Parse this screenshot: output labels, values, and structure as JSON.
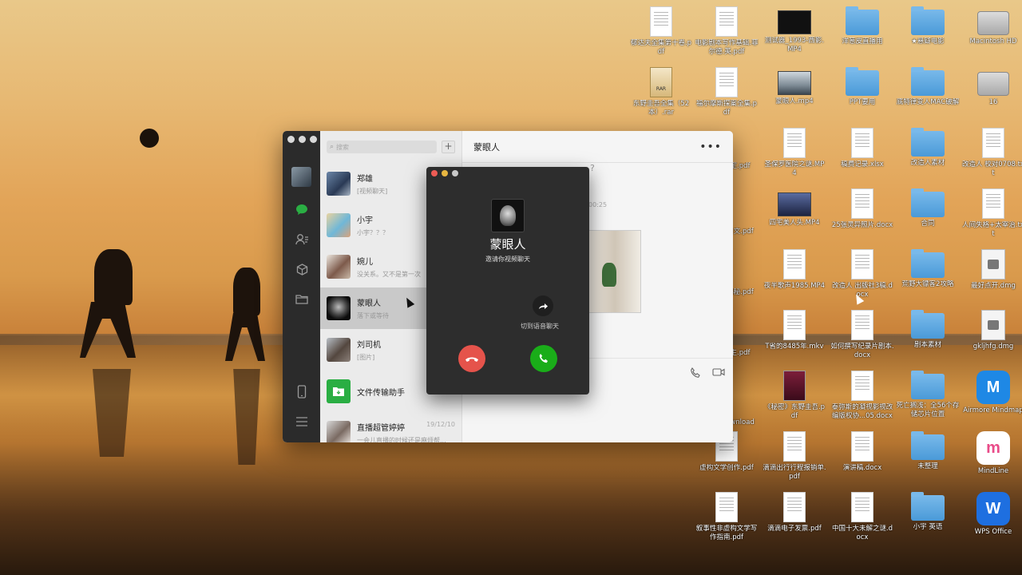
{
  "desktop": {
    "icons": [
      {
        "label": "郁达夫全集第十卷.pdf",
        "type": "doc"
      },
      {
        "label": "电影剧本写作基础.菲尔德.英.pdf",
        "type": "doc"
      },
      {
        "label": "测试器_1993-西影.MP4",
        "type": "video"
      },
      {
        "label": "洋葱皮直播用",
        "type": "folder"
      },
      {
        "label": "★悬疑电影",
        "type": "folder"
      },
      {
        "label": "Macintosh HD",
        "type": "disk"
      },
      {
        "label": "东野圭吾全集（52本）.rar",
        "type": "rar"
      },
      {
        "label": "福尔摩斯探案全集.pdf",
        "type": "doc"
      },
      {
        "label": "蒙眼人.mp4",
        "type": "video"
      },
      {
        "label": "PPT要用",
        "type": "folder"
      },
      {
        "label": "底特律变人MAC破解",
        "type": "folder"
      },
      {
        "label": "16",
        "type": "disk"
      },
      {
        "label": "圣保罗医院之谜.MP4",
        "type": "doc"
      },
      {
        "label": "稿费记录.xlsx",
        "type": "doc"
      },
      {
        "label": "改造人素材",
        "type": "folder"
      },
      {
        "label": "改造人 校对0708.txt",
        "type": "doc"
      },
      {
        "label": "四宅美人头.MP4",
        "type": "video"
      },
      {
        "label": "25张灵异照片.docx",
        "type": "doc"
      },
      {
        "label": "合同",
        "type": "folder"
      },
      {
        "label": "人间失格+太宰治.txt",
        "type": "doc"
      },
      {
        "label": "夜半歌声1985.MP4",
        "type": "doc"
      },
      {
        "label": "改造人 出版社3稿.docx",
        "type": "doc"
      },
      {
        "label": "荒野大镖客2攻略",
        "type": "folder"
      },
      {
        "label": "最好点开.dmg",
        "type": "dmg"
      },
      {
        "label": "T省的8485年.mkv",
        "type": "doc"
      },
      {
        "label": "如何撰写纪录片剧本.docx",
        "type": "doc"
      },
      {
        "label": "剧本素材",
        "type": "folder"
      },
      {
        "label": "gkljhfg.dmg",
        "type": "dmg"
      },
      {
        "label": "《秘密》东野圭吾.pdf",
        "type": "book"
      },
      {
        "label": "泰弥斯的凝视影视改编版权协...05.docx",
        "type": "doc"
      },
      {
        "label": "死亡搁浅：全56个存储芯片位置",
        "type": "folder"
      },
      {
        "label": "Airmore Mindmap",
        "type": "app"
      },
      {
        "label": "虚构文学创作.pdf",
        "type": "doc"
      },
      {
        "label": "滴滴出行行程报销单.pdf",
        "type": "doc"
      },
      {
        "label": "演讲稿.docx",
        "type": "doc"
      },
      {
        "label": "未整理",
        "type": "folder"
      },
      {
        "label": "MindLine",
        "type": "app"
      },
      {
        "label": "叙事性非虚构文学写作指南.pdf",
        "type": "doc"
      },
      {
        "label": "滴滴电子发票.pdf",
        "type": "doc"
      },
      {
        "label": "中国十大未解之谜.docx",
        "type": "doc"
      },
      {
        "label": "小宇 英语",
        "type": "folder"
      },
      {
        "label": "WPS Office",
        "type": "app"
      }
    ],
    "partial_labels": {
      "pdf1": "定.pdf",
      "pdf2": "与文.pdf",
      "pdf3": "揭秘.pdf",
      "pdf4": "生.pdf",
      "download": "ownload"
    },
    "file_tags": {
      "rar": "RAR",
      "xlsx": "XLSX",
      "txt": "TXT",
      "docx": "DOCX",
      "pdf": "PDF"
    }
  },
  "wechat": {
    "search_placeholder": "搜索",
    "plus_label": "+",
    "conversation_title": "蒙眼人",
    "more_label": "•••",
    "chats": [
      {
        "name": "郑雄",
        "msg": "[视频聊天]",
        "time": ""
      },
      {
        "name": "小宇",
        "msg": "小宇？？？",
        "time": ""
      },
      {
        "name": "婉儿",
        "msg": "没关系。又不是第一次",
        "time": ""
      },
      {
        "name": "蒙眼人",
        "msg": "落下或等待",
        "time": ""
      },
      {
        "name": "刘司机",
        "msg": "[图片]",
        "time": ""
      },
      {
        "name": "文件传输助手",
        "msg": "",
        "time": ""
      },
      {
        "name": "直播超管婷婷",
        "msg": "一会儿直播的时候还是麻烦帮...",
        "time": "19/12/10"
      }
    ],
    "chat_time_fragment": "00:25",
    "chat_qmark": "?"
  },
  "call": {
    "name": "蒙眼人",
    "subtitle": "邀请你视频聊天",
    "switch_label": "切到语音聊天",
    "decline_icon": "phone-hangup-icon",
    "accept_icon": "phone-accept-icon"
  },
  "colors": {
    "wechat_green": "#1aad19",
    "decline_red": "#e5534b",
    "rail_dark": "#2b2b2b"
  }
}
